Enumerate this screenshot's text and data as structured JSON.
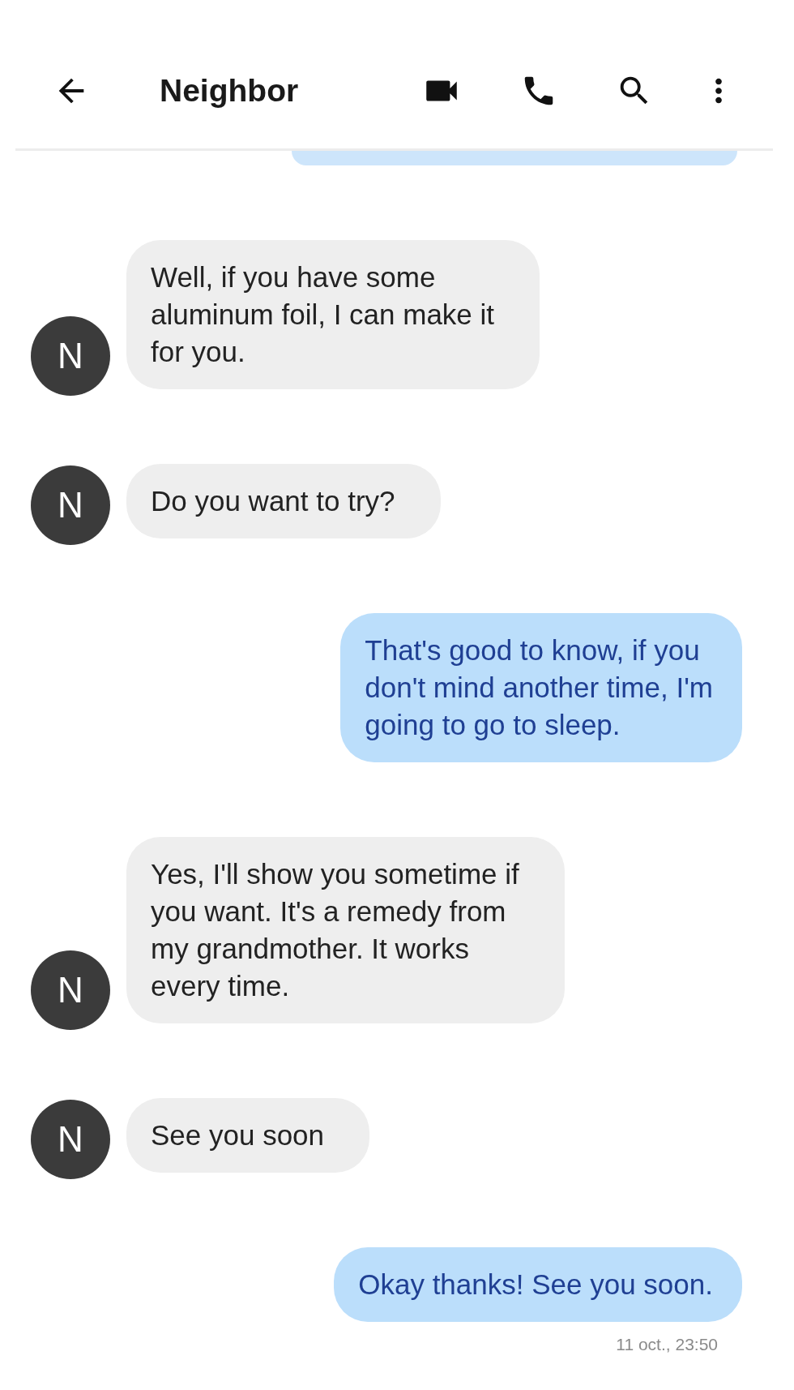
{
  "header": {
    "back": true,
    "title": "Neighbor",
    "actions": [
      {
        "kind": "video"
      },
      {
        "kind": "call"
      },
      {
        "kind": "search"
      },
      {
        "kind": "more"
      }
    ]
  },
  "messages": [
    {
      "kind": "clipped"
    },
    {
      "kind": "incoming",
      "avatar": "N",
      "text": "Well, if you have some\naluminum foil, I can make it\nfor you."
    },
    {
      "kind": "incoming",
      "avatar": "N",
      "text": "Do you want to try?"
    },
    {
      "kind": "outgoing",
      "text": "That's good to know, if you\ndon't mind another time, I'm\ngoing to go to sleep."
    },
    {
      "kind": "incoming",
      "avatar": "N",
      "text": "Yes, I'll show you sometime if\nyou want. It's a remedy from\nmy grandmother. It works\nevery time."
    },
    {
      "kind": "incoming",
      "avatar": "N",
      "text": "See you soon"
    },
    {
      "kind": "outgoing",
      "text": "Okay thanks! See you soon.",
      "timestamp": "11 oct., 23:50"
    }
  ]
}
